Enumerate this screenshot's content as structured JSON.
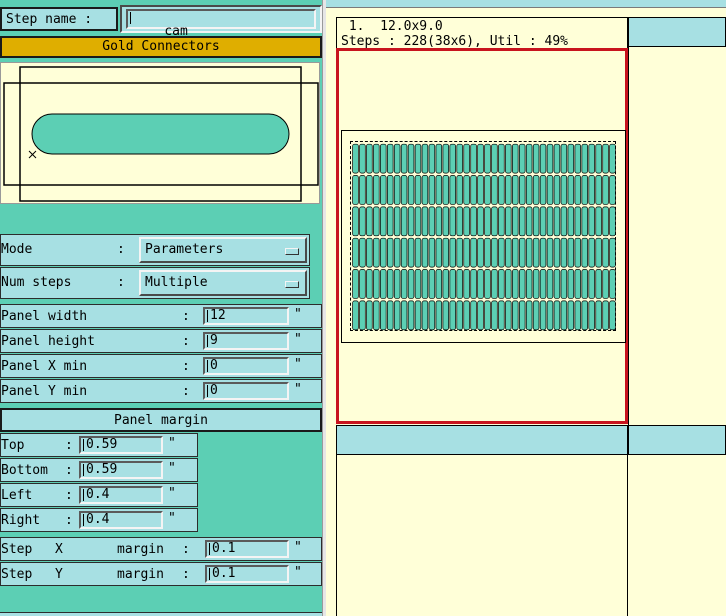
{
  "step_name": {
    "label": "Step name :",
    "value": "cam"
  },
  "banner": "Gold Connectors",
  "mode": {
    "label": "Mode",
    "colon": ":",
    "value": "Parameters",
    "icon": "option-menu-icon"
  },
  "num_steps": {
    "label": "Num steps",
    "colon": ":",
    "value": "Multiple",
    "icon": "option-menu-icon"
  },
  "panel": {
    "width": {
      "label": "Panel width",
      "colon": ":",
      "value": "12",
      "unit": "\""
    },
    "height": {
      "label": "Panel height",
      "colon": ":",
      "value": "9",
      "unit": "\""
    },
    "xmin": {
      "label": "Panel X min",
      "colon": ":",
      "value": "0",
      "unit": "\""
    },
    "ymin": {
      "label": "Panel Y min",
      "colon": ":",
      "value": "0",
      "unit": "\""
    }
  },
  "margin": {
    "title": "Panel margin",
    "top": {
      "label": "Top",
      "colon": ":",
      "value": "0.59",
      "unit": "\""
    },
    "bottom": {
      "label": "Bottom",
      "colon": ":",
      "value": "0.59",
      "unit": "\""
    },
    "left": {
      "label": "Left",
      "colon": ":",
      "value": "0.4",
      "unit": "\""
    },
    "right": {
      "label": "Right",
      "colon": ":",
      "value": "0.4",
      "unit": "\""
    }
  },
  "step_margin": {
    "x": {
      "label": "Step",
      "axis": "X",
      "word": "margin",
      "colon": ":",
      "value": "0.1",
      "unit": "\""
    },
    "y": {
      "label": "Step",
      "axis": "Y",
      "word": "margin",
      "colon": ":",
      "value": "0.1",
      "unit": "\""
    }
  },
  "preview": {
    "line1": " 1.  12.0x9.0",
    "line2": "Steps : 228(38x6), Util : 49%",
    "columns": 38,
    "rows": 6
  },
  "colors": {
    "bg": "#5ccfb4",
    "panel": "#a7e0e3",
    "canvas": "#ffffd8",
    "banner": "#dfae00",
    "frame": "#c8141e"
  }
}
